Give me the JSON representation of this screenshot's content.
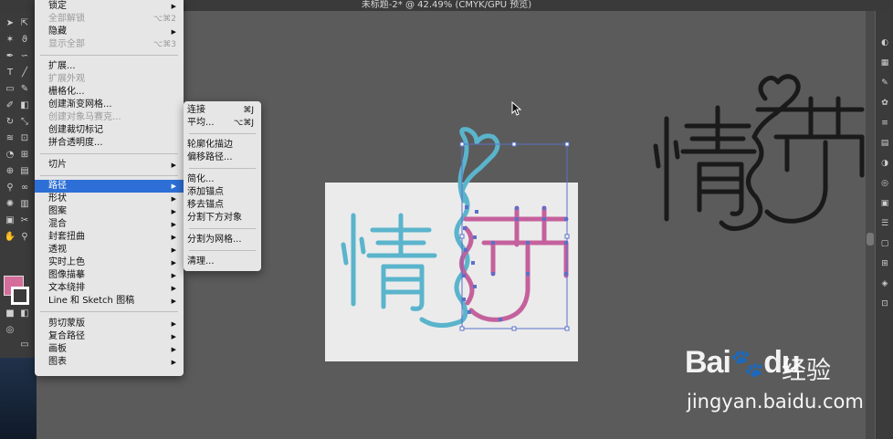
{
  "window": {
    "title": "未标题-2* @ 42.49% (CMYK/GPU 预览)"
  },
  "colors": {
    "menu_highlight": "#2d6fd6",
    "fill_swatch": "#d56d9b",
    "art_blue": "#5ab4cc",
    "art_pink": "#c4619c",
    "selection_blue": "#5a70c8"
  },
  "object_menu": {
    "items": [
      {
        "label": "锁定",
        "arrow": "▶"
      },
      {
        "label": "全部解锁",
        "shortcut": "⌥⌘2",
        "disabled": true
      },
      {
        "label": "隐藏",
        "arrow": "▶"
      },
      {
        "label": "显示全部",
        "shortcut": "⌥⌘3",
        "disabled": true
      },
      {
        "label": "扩展..."
      },
      {
        "label": "扩展外观",
        "disabled": true
      },
      {
        "label": "栅格化..."
      },
      {
        "label": "创建渐变网格..."
      },
      {
        "label": "创建对象马赛克...",
        "disabled": true
      },
      {
        "label": "创建裁切标记"
      },
      {
        "label": "拼合透明度..."
      },
      {
        "label": "切片",
        "arrow": "▶"
      },
      {
        "label": "路径",
        "arrow": "▶",
        "highlighted": true
      },
      {
        "label": "形状",
        "arrow": "▶"
      },
      {
        "label": "图案",
        "arrow": "▶"
      },
      {
        "label": "混合",
        "arrow": "▶"
      },
      {
        "label": "封套扭曲",
        "arrow": "▶"
      },
      {
        "label": "透视",
        "arrow": "▶"
      },
      {
        "label": "实时上色",
        "arrow": "▶"
      },
      {
        "label": "图像描摹",
        "arrow": "▶"
      },
      {
        "label": "文本绕排",
        "arrow": "▶"
      },
      {
        "label": "Line 和 Sketch 图稿",
        "arrow": "▶"
      },
      {
        "label": "剪切蒙版",
        "arrow": "▶"
      },
      {
        "label": "复合路径",
        "arrow": "▶"
      },
      {
        "label": "画板",
        "arrow": "▶"
      },
      {
        "label": "图表",
        "arrow": "▶"
      }
    ]
  },
  "path_submenu": {
    "items": [
      {
        "label": "连接",
        "shortcut": "⌘J"
      },
      {
        "label": "平均...",
        "shortcut": "⌥⌘J"
      },
      {
        "label": "轮廓化描边"
      },
      {
        "label": "偏移路径..."
      },
      {
        "label": "简化..."
      },
      {
        "label": "添加锚点"
      },
      {
        "label": "移去锚点"
      },
      {
        "label": "分割下方对象"
      },
      {
        "label": "分割为网格..."
      },
      {
        "label": "清理..."
      }
    ]
  },
  "watermark": {
    "url": "jingyan.baidu.com"
  }
}
